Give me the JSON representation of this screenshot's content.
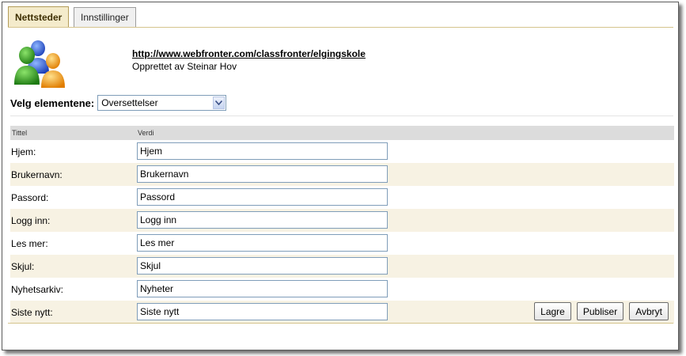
{
  "tabs": [
    {
      "label": "Nettsteder",
      "active": true
    },
    {
      "label": "Innstillinger",
      "active": false
    }
  ],
  "site": {
    "url": "http://www.webfronter.com/classfronter/elgingskole",
    "creator": "Opprettet av Steinar Hov",
    "icon": "users-group-icon"
  },
  "selector": {
    "label": "Velg elementene:",
    "value": "Oversettelser"
  },
  "table": {
    "headers": {
      "title": "Tittel",
      "value": "Verdi"
    },
    "rows": [
      {
        "label": "Hjem:",
        "value": "Hjem"
      },
      {
        "label": "Brukernavn:",
        "value": "Brukernavn"
      },
      {
        "label": "Passord:",
        "value": "Passord"
      },
      {
        "label": "Logg inn:",
        "value": "Logg inn"
      },
      {
        "label": "Les mer:",
        "value": "Les mer"
      },
      {
        "label": "Skjul:",
        "value": "Skjul"
      },
      {
        "label": "Nyhetsarkiv:",
        "value": "Nyheter"
      },
      {
        "label": "Siste nytt:",
        "value": "Siste nytt"
      }
    ]
  },
  "buttons": {
    "save": "Lagre",
    "publish": "Publiser",
    "cancel": "Avbryt"
  },
  "colors": {
    "active_tab_bg": "#f4ebcb",
    "alt_row_bg": "#f7f2e3",
    "header_bg": "#dcdcdc"
  }
}
